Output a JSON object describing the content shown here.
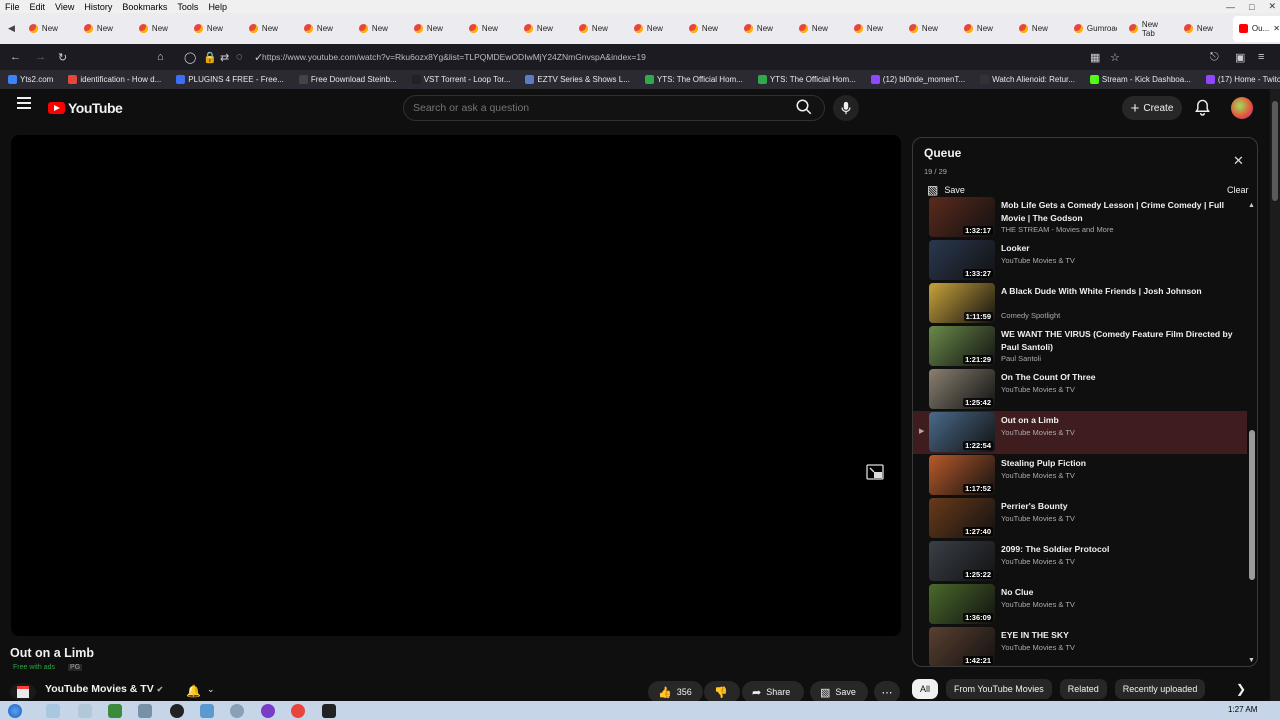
{
  "browser": {
    "menu": [
      "File",
      "Edit",
      "View",
      "History",
      "Bookmarks",
      "Tools",
      "Help"
    ],
    "tabs": [
      "New",
      "New",
      "New",
      "New",
      "New",
      "New",
      "New",
      "New",
      "New",
      "New",
      "New",
      "New",
      "New",
      "New",
      "New",
      "New",
      "New",
      "New",
      "New",
      "Gumroad",
      "New Tab",
      "New"
    ],
    "active_tab": "Ou...",
    "url": "https://www.youtube.com/watch?v=Rku6ozx8Yg&list=TLPQMDEwODIwMjY24ZNmGnvspA&index=19",
    "bookmarks": [
      {
        "label": "Yts2.com",
        "color": "#3b83f6"
      },
      {
        "label": "identification - How d...",
        "color": "#e8453c"
      },
      {
        "label": "PLUGINS 4 FREE - Free...",
        "color": "#3b6ff6"
      },
      {
        "label": "Free Download Steinb...",
        "color": "#444"
      },
      {
        "label": "VST Torrent - Loop Tor...",
        "color": "#222"
      },
      {
        "label": "EZTV Series & Shows L...",
        "color": "#5b7cc4"
      },
      {
        "label": "YTS: The Official Hom...",
        "color": "#2fa84f"
      },
      {
        "label": "YTS: The Official Hom...",
        "color": "#2fa84f"
      },
      {
        "label": "(12) bl0nde_momenT...",
        "color": "#9146ff"
      },
      {
        "label": "Watch Alienoid: Retur...",
        "color": "#333"
      },
      {
        "label": "Stream - Kick Dashboa...",
        "color": "#53fc18"
      },
      {
        "label": "(17) Home - Twitch",
        "color": "#9146ff"
      }
    ]
  },
  "youtube": {
    "logo_text": "YouTube",
    "search_placeholder": "Search or ask a question",
    "create_label": "Create"
  },
  "video": {
    "title": "Out on a Limb",
    "free_label": "Free with ads",
    "rating": "PG",
    "channel": "YouTube Movies & TV",
    "likes": "356",
    "share_label": "Share",
    "save_label": "Save"
  },
  "queue": {
    "title": "Queue",
    "position": "19 / 29",
    "save_label": "Save",
    "clear_label": "Clear",
    "items": [
      {
        "title": "Mob Life Gets a Comedy Lesson | Crime Comedy | Full Movie | The Godson",
        "channel": "THE STREAM - Movies and More",
        "duration": "1:32:17",
        "playing": false,
        "thumb": "#5b2a1c"
      },
      {
        "title": "Looker",
        "channel": "YouTube Movies & TV",
        "duration": "1:33:27",
        "playing": false,
        "thumb": "#2a3850"
      },
      {
        "title": "A Black Dude With White Friends | Josh Johnson",
        "channel": "Comedy Spotlight",
        "duration": "1:11:59",
        "playing": false,
        "thumb": "#c9a33b"
      },
      {
        "title": "WE WANT THE VIRUS (Comedy Feature Film Directed by Paul Santoli)",
        "channel": "Paul Santoli",
        "duration": "1:21:29",
        "playing": false,
        "thumb": "#6a8a4a"
      },
      {
        "title": "On The Count Of Three",
        "channel": "YouTube Movies & TV",
        "duration": "1:25:42",
        "playing": false,
        "thumb": "#8a8070"
      },
      {
        "title": "Out on a Limb",
        "channel": "YouTube Movies & TV",
        "duration": "1:22:54",
        "playing": true,
        "thumb": "#4a6a8a"
      },
      {
        "title": "Stealing Pulp Fiction",
        "channel": "YouTube Movies & TV",
        "duration": "1:17:52",
        "playing": false,
        "thumb": "#b85a2a"
      },
      {
        "title": "Perrier's Bounty",
        "channel": "YouTube Movies & TV",
        "duration": "1:27:40",
        "playing": false,
        "thumb": "#6a3a1a"
      },
      {
        "title": "2099: The Soldier Protocol",
        "channel": "YouTube Movies & TV",
        "duration": "1:25:22",
        "playing": false,
        "thumb": "#3a4048"
      },
      {
        "title": "No Clue",
        "channel": "YouTube Movies & TV",
        "duration": "1:36:09",
        "playing": false,
        "thumb": "#4a6a2a"
      },
      {
        "title": "EYE IN THE SKY",
        "channel": "YouTube Movies & TV",
        "duration": "1:42:21",
        "playing": false,
        "thumb": "#5a4030"
      }
    ]
  },
  "chips": [
    "All",
    "From YouTube Movies",
    "Related",
    "Recently uploaded"
  ],
  "taskbar": {
    "clock": "1:27 AM"
  }
}
